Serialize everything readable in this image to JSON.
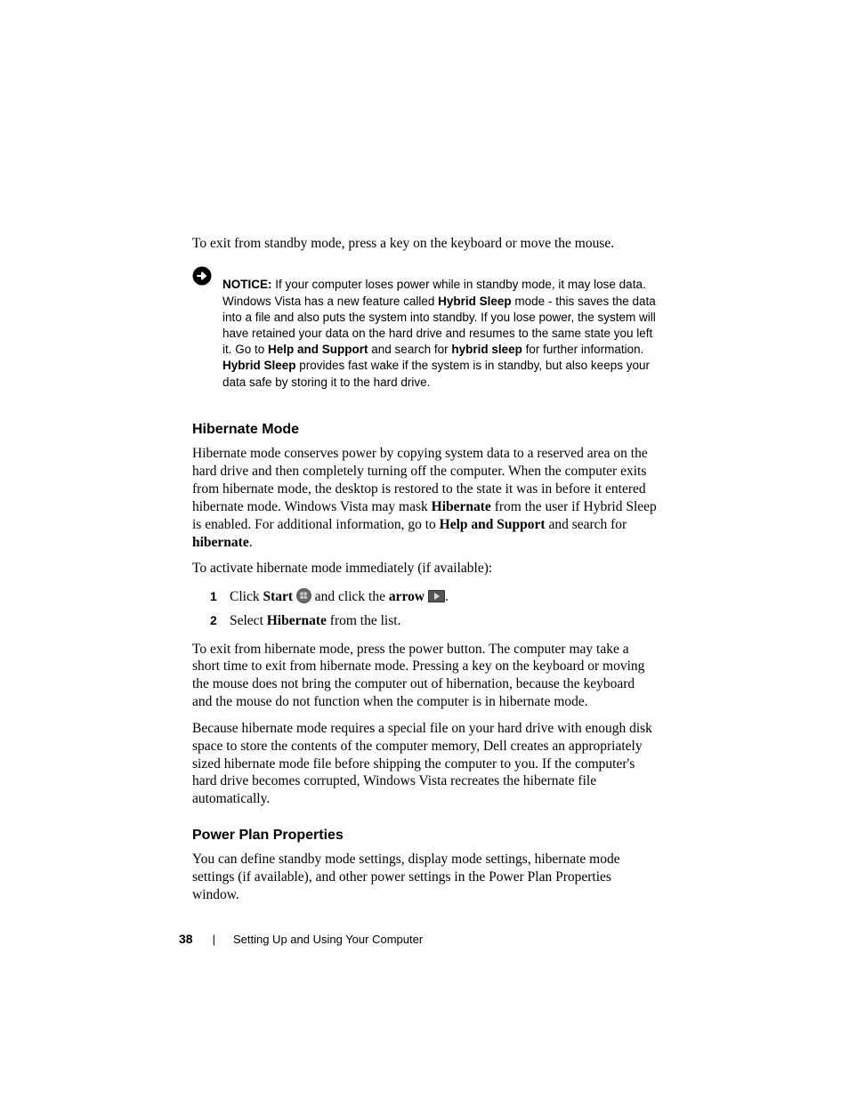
{
  "intro": "To exit from standby mode, press a key on the keyboard or move the mouse.",
  "notice": {
    "label": "NOTICE:",
    "t1": " If your computer loses power while in standby mode, it may lose data. Windows Vista has a new feature called ",
    "b1": "Hybrid Sleep",
    "t2": " mode - this saves the data into a file and also puts the system into standby. If you lose power, the system will have retained your data on the hard drive and resumes to the same state you left it. Go to ",
    "b2": "Help and Support",
    "t3": " and search for ",
    "b3": "hybrid sleep",
    "t4": " for further information. ",
    "b4": "Hybrid Sleep",
    "t5": " provides fast wake if the system is in standby, but also keeps your data safe by storing it to the hard drive."
  },
  "hibernate": {
    "heading": "Hibernate Mode",
    "p1a": "Hibernate mode conserves power by copying system data to a reserved area on the hard drive and then completely turning off the computer. When the computer exits from hibernate mode, the desktop is restored to the state it was in before it entered hibernate mode. Windows Vista may mask ",
    "p1b": "Hibernate",
    "p1c": " from the user if Hybrid Sleep is enabled. For additional information, go to ",
    "p1d": "Help and Support",
    "p1e": " and search for ",
    "p1f": "hibernate",
    "p1g": ".",
    "p2": "To activate hibernate mode immediately (if available):",
    "step1a": "Click ",
    "step1b": "Start",
    "step1c": " and click the ",
    "step1d": "arrow",
    "step1e": ".",
    "step2a": "Select ",
    "step2b": "Hibernate",
    "step2c": " from the list.",
    "p3": "To exit from hibernate mode, press the power button. The computer may take a short time to exit from hibernate mode. Pressing a key on the keyboard or moving the mouse does not bring the computer out of hibernation, because the keyboard and the mouse do not function when the computer is in hibernate mode.",
    "p4": "Because hibernate mode requires a special file on your hard drive with enough disk space to store the contents of the computer memory, Dell creates an appropriately sized hibernate mode file before shipping the computer to you. If the computer's hard drive becomes corrupted, Windows Vista recreates the hibernate file automatically."
  },
  "powerplan": {
    "heading": "Power Plan Properties",
    "p1": "You can define standby mode settings, display mode settings, hibernate mode settings (if available), and other power settings in the Power Plan Properties window."
  },
  "footer": {
    "page": "38",
    "section": "Setting Up and Using Your Computer"
  }
}
